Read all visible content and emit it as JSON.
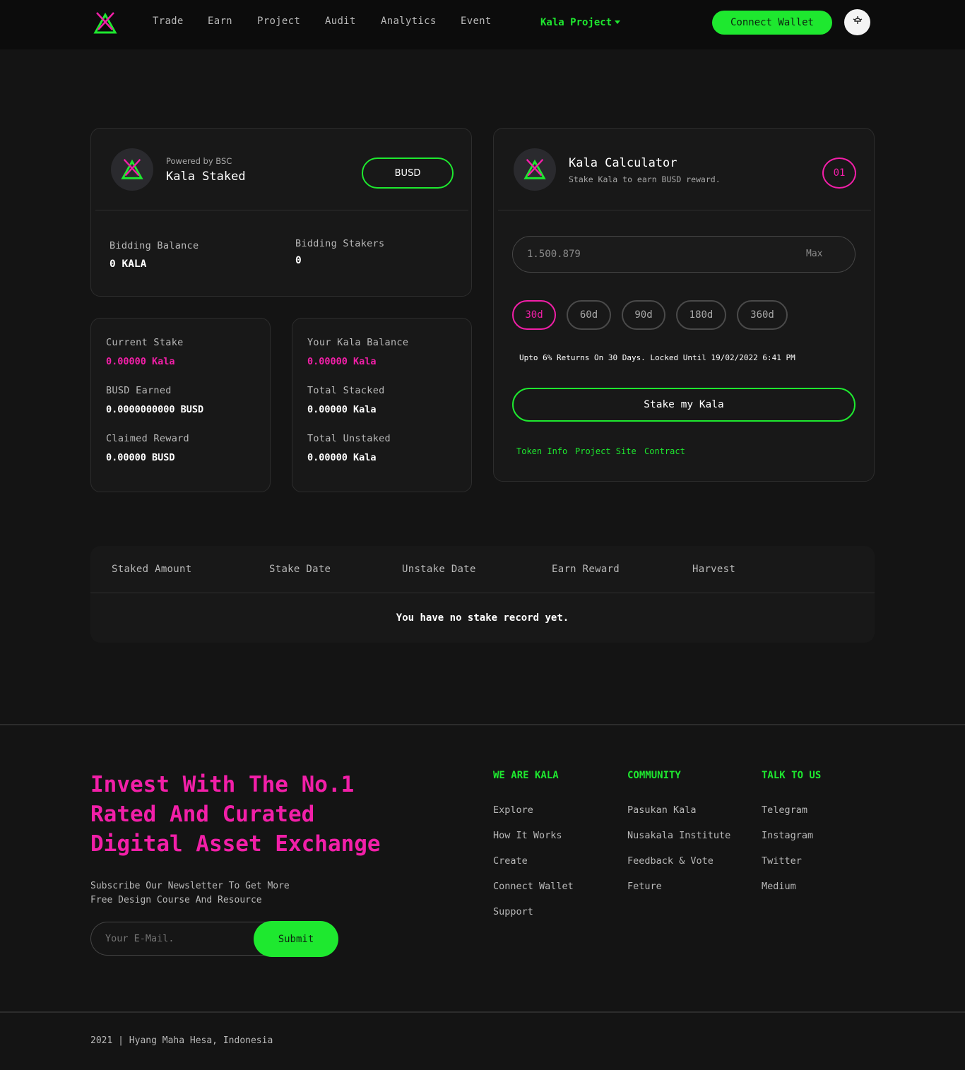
{
  "nav": {
    "items": [
      "Trade",
      "Earn",
      "Project",
      "Audit",
      "Analytics",
      "Event"
    ],
    "project_menu": "Kala Project",
    "connect_wallet": "Connect Wallet"
  },
  "staked_card": {
    "powered_by": "Powered by BSC",
    "title": "Kala Staked",
    "token_button": "BUSD",
    "bidding_balance_label": "Bidding Balance",
    "bidding_balance_value": "0 KALA",
    "bidding_stakers_label": "Bidding Stakers",
    "bidding_stakers_value": "0"
  },
  "stake_stats": {
    "current_stake_label": "Current Stake",
    "current_stake_value": "0.00000 Kala",
    "busd_earned_label": "BUSD Earned",
    "busd_earned_value": "0.0000000000 BUSD",
    "claimed_reward_label": "Claimed Reward",
    "claimed_reward_value": "0.00000 BUSD"
  },
  "balance_stats": {
    "kala_balance_label": "Your Kala Balance",
    "kala_balance_value": "0.00000 Kala",
    "total_stacked_label": "Total Stacked",
    "total_stacked_value": "0.00000 Kala",
    "total_unstaked_label": "Total Unstaked",
    "total_unstaked_value": "0.00000 Kala"
  },
  "calculator": {
    "title": "Kala Calculator",
    "subtitle": "Stake Kala to earn BUSD reward.",
    "badge": "01",
    "amount_placeholder": "1.500.879",
    "max_label": "Max",
    "durations": [
      "30d",
      "60d",
      "90d",
      "180d",
      "360d"
    ],
    "selected_duration": "30d",
    "returns_note": "Upto 6% Returns On 30 Days. Locked Until 19/02/2022 6:41 PM",
    "stake_button": "Stake my Kala",
    "links": [
      "Token Info",
      "Project Site",
      "Contract"
    ]
  },
  "table": {
    "columns": [
      "Staked Amount",
      "Stake Date",
      "Unstake Date",
      "Earn Reward",
      "Harvest"
    ],
    "empty_message": "You have no stake record yet."
  },
  "footer": {
    "headline": "Invest With The No.1 Rated And Curated Digital Asset Exchange",
    "headline_lines": [
      "Invest With The No.1",
      "Rated And Curated",
      "Digital Asset Exchange"
    ],
    "newsletter_lines": [
      "Subscribe Our Newsletter To Get More",
      "Free Design Course And Resource"
    ],
    "email_placeholder": "Your E-Mail.",
    "submit_label": "Submit",
    "columns": [
      {
        "heading": "WE ARE KALA",
        "links": [
          "Explore",
          "How It Works",
          "Create",
          "Connect Wallet",
          "Support"
        ]
      },
      {
        "heading": "COMMUNITY",
        "links": [
          "Pasukan Kala",
          "Nusakala Institute",
          "Feedback & Vote",
          "Feture"
        ]
      },
      {
        "heading": "TALK TO US",
        "links": [
          "Telegram",
          "Instagram",
          "Twitter",
          "Medium"
        ]
      }
    ],
    "copyright": "2021 | Hyang Maha Hesa, Indonesia"
  },
  "colors": {
    "accent_green": "#1ee82f",
    "accent_pink": "#f21fa8",
    "background": "#141414",
    "card": "#181818"
  },
  "icons": {
    "logo": "kala-logo-icon",
    "theme_toggle": "lamp-icon"
  }
}
